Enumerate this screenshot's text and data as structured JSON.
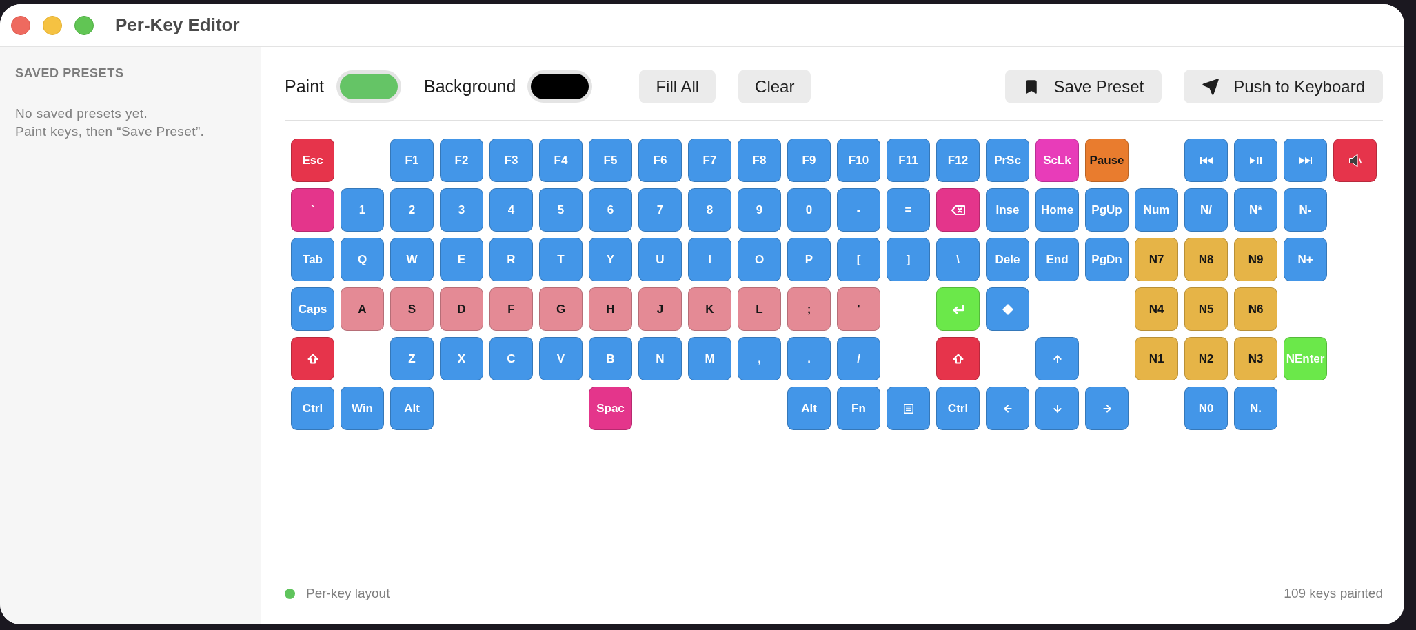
{
  "window": {
    "title": "Per-Key Editor"
  },
  "sidebar": {
    "heading": "SAVED PRESETS",
    "empty_message": [
      "No saved presets yet.",
      "Paint keys, then “Save Preset”."
    ]
  },
  "toolbar": {
    "paint": {
      "label": "Paint",
      "color": "#65c466"
    },
    "background": {
      "label": "Background",
      "color": "#000000"
    },
    "edit_buttons": [
      "Fill All",
      "Clear"
    ],
    "action_buttons": [
      {
        "kind": "bookmark",
        "label": "Save Preset"
      },
      {
        "kind": "send",
        "label": "Push to Keyboard"
      }
    ]
  },
  "keyboard": {
    "rows": [
      {
        "keys": [
          {
            "kind": "text",
            "label": "Esc",
            "color": "#e6344b",
            "dark_label": false
          },
          {
            "kind": "text",
            "label": "F1",
            "color": "#4396e8",
            "dark_label": false
          },
          {
            "kind": "text",
            "label": "F2",
            "color": "#4396e8",
            "dark_label": false
          },
          {
            "kind": "text",
            "label": "F3",
            "color": "#4396e8",
            "dark_label": false
          },
          {
            "kind": "text",
            "label": "F4",
            "color": "#4396e8",
            "dark_label": false
          },
          {
            "kind": "text",
            "label": "F5",
            "color": "#4396e8",
            "dark_label": false
          },
          {
            "kind": "text",
            "label": "F6",
            "color": "#4396e8",
            "dark_label": false
          },
          {
            "kind": "text",
            "label": "F7",
            "color": "#4396e8",
            "dark_label": false
          },
          {
            "kind": "text",
            "label": "F8",
            "color": "#4396e8",
            "dark_label": false
          },
          {
            "kind": "text",
            "label": "F9",
            "color": "#4396e8",
            "dark_label": false
          },
          {
            "kind": "text",
            "label": "F10",
            "color": "#4396e8",
            "dark_label": false
          },
          {
            "kind": "text",
            "label": "F11",
            "color": "#4396e8",
            "dark_label": false
          },
          {
            "kind": "text",
            "label": "F12",
            "color": "#4396e8",
            "dark_label": false
          },
          {
            "kind": "text",
            "label": "PrSc",
            "color": "#4396e8",
            "dark_label": false
          },
          {
            "kind": "text",
            "label": "ScLk",
            "color": "#e83cb9",
            "dark_label": false
          },
          {
            "kind": "text",
            "label": "Pause",
            "color": "#e97c2e",
            "dark_label": true
          },
          {
            "kind": "previous",
            "color": "#4396e8",
            "dark_label": false
          },
          {
            "kind": "playpause",
            "color": "#4396e8",
            "dark_label": false
          },
          {
            "kind": "next",
            "color": "#4396e8",
            "dark_label": false
          },
          {
            "kind": "mute",
            "color": "#e6344b",
            "dark_label": false
          }
        ]
      },
      {
        "keys": [
          {
            "kind": "text",
            "label": "`",
            "color": "#e4358b",
            "dark_label": false
          },
          {
            "kind": "text",
            "label": "1",
            "color": "#4396e8",
            "dark_label": false
          },
          {
            "kind": "text",
            "label": "2",
            "color": "#4396e8",
            "dark_label": false
          },
          {
            "kind": "text",
            "label": "3",
            "color": "#4396e8",
            "dark_label": false
          },
          {
            "kind": "text",
            "label": "4",
            "color": "#4396e8",
            "dark_label": false
          },
          {
            "kind": "text",
            "label": "5",
            "color": "#4396e8",
            "dark_label": false
          },
          {
            "kind": "text",
            "label": "6",
            "color": "#4396e8",
            "dark_label": false
          },
          {
            "kind": "text",
            "label": "7",
            "color": "#4396e8",
            "dark_label": false
          },
          {
            "kind": "text",
            "label": "8",
            "color": "#4396e8",
            "dark_label": false
          },
          {
            "kind": "text",
            "label": "9",
            "color": "#4396e8",
            "dark_label": false
          },
          {
            "kind": "text",
            "label": "0",
            "color": "#4396e8",
            "dark_label": false
          },
          {
            "kind": "text",
            "label": "-",
            "color": "#4396e8",
            "dark_label": false
          },
          {
            "kind": "text",
            "label": "=",
            "color": "#4396e8",
            "dark_label": false
          },
          {
            "kind": "backspace",
            "color": "#e4358b",
            "dark_label": false
          },
          {
            "kind": "text",
            "label": "Inse",
            "color": "#4396e8",
            "dark_label": false
          },
          {
            "kind": "text",
            "label": "Home",
            "color": "#4396e8",
            "dark_label": false
          },
          {
            "kind": "text",
            "label": "PgUp",
            "color": "#4396e8",
            "dark_label": false
          },
          {
            "kind": "text",
            "label": "Num",
            "color": "#4396e8",
            "dark_label": false
          },
          {
            "kind": "text",
            "label": "N/",
            "color": "#4396e8",
            "dark_label": false
          },
          {
            "kind": "text",
            "label": "N*",
            "color": "#4396e8",
            "dark_label": false
          },
          {
            "kind": "text",
            "label": "N-",
            "color": "#4396e8",
            "dark_label": false
          }
        ]
      },
      {
        "keys": [
          {
            "kind": "text",
            "label": "Tab",
            "color": "#4396e8",
            "dark_label": false
          },
          {
            "kind": "text",
            "label": "Q",
            "color": "#4396e8",
            "dark_label": false
          },
          {
            "kind": "text",
            "label": "W",
            "color": "#4396e8",
            "dark_label": false
          },
          {
            "kind": "text",
            "label": "E",
            "color": "#4396e8",
            "dark_label": false
          },
          {
            "kind": "text",
            "label": "R",
            "color": "#4396e8",
            "dark_label": false
          },
          {
            "kind": "text",
            "label": "T",
            "color": "#4396e8",
            "dark_label": false
          },
          {
            "kind": "text",
            "label": "Y",
            "color": "#4396e8",
            "dark_label": false
          },
          {
            "kind": "text",
            "label": "U",
            "color": "#4396e8",
            "dark_label": false
          },
          {
            "kind": "text",
            "label": "I",
            "color": "#4396e8",
            "dark_label": false
          },
          {
            "kind": "text",
            "label": "O",
            "color": "#4396e8",
            "dark_label": false
          },
          {
            "kind": "text",
            "label": "P",
            "color": "#4396e8",
            "dark_label": false
          },
          {
            "kind": "text",
            "label": "[",
            "color": "#4396e8",
            "dark_label": false
          },
          {
            "kind": "text",
            "label": "]",
            "color": "#4396e8",
            "dark_label": false
          },
          {
            "kind": "text",
            "label": "\\",
            "color": "#4396e8",
            "dark_label": false
          },
          {
            "kind": "text",
            "label": "Dele",
            "color": "#4396e8",
            "dark_label": false
          },
          {
            "kind": "text",
            "label": "End",
            "color": "#4396e8",
            "dark_label": false
          },
          {
            "kind": "text",
            "label": "PgDn",
            "color": "#4396e8",
            "dark_label": false
          },
          {
            "kind": "text",
            "label": "N7",
            "color": "#e6b447",
            "dark_label": true
          },
          {
            "kind": "text",
            "label": "N8",
            "color": "#e6b447",
            "dark_label": true
          },
          {
            "kind": "text",
            "label": "N9",
            "color": "#e6b447",
            "dark_label": true
          },
          {
            "kind": "text",
            "label": "N+",
            "color": "#4396e8",
            "dark_label": false
          }
        ]
      },
      {
        "keys": [
          {
            "kind": "text",
            "label": "Caps",
            "color": "#4396e8",
            "dark_label": false
          },
          {
            "kind": "text",
            "label": "A",
            "color": "#e48a95",
            "dark_label": true
          },
          {
            "kind": "text",
            "label": "S",
            "color": "#e48a95",
            "dark_label": true
          },
          {
            "kind": "text",
            "label": "D",
            "color": "#e48a95",
            "dark_label": true
          },
          {
            "kind": "text",
            "label": "F",
            "color": "#e48a95",
            "dark_label": true
          },
          {
            "kind": "text",
            "label": "G",
            "color": "#e48a95",
            "dark_label": true
          },
          {
            "kind": "text",
            "label": "H",
            "color": "#e48a95",
            "dark_label": true
          },
          {
            "kind": "text",
            "label": "J",
            "color": "#e48a95",
            "dark_label": true
          },
          {
            "kind": "text",
            "label": "K",
            "color": "#e48a95",
            "dark_label": true
          },
          {
            "kind": "text",
            "label": "L",
            "color": "#e48a95",
            "dark_label": true
          },
          {
            "kind": "text",
            "label": ";",
            "color": "#e48a95",
            "dark_label": true
          },
          {
            "kind": "text",
            "label": "'",
            "color": "#e48a95",
            "dark_label": true
          },
          {
            "kind": "enter",
            "color": "#6be84a",
            "dark_label": false
          },
          {
            "kind": "diamond",
            "color": "#4396e8",
            "dark_label": false
          },
          {
            "kind": "text",
            "label": "N4",
            "color": "#e6b447",
            "dark_label": true
          },
          {
            "kind": "text",
            "label": "N5",
            "color": "#e6b447",
            "dark_label": true
          },
          {
            "kind": "text",
            "label": "N6",
            "color": "#e6b447",
            "dark_label": true
          }
        ]
      },
      {
        "keys": [
          {
            "kind": "shift",
            "color": "#e6344b",
            "dark_label": false
          },
          {
            "kind": "text",
            "label": "Z",
            "color": "#4396e8",
            "dark_label": false
          },
          {
            "kind": "text",
            "label": "X",
            "color": "#4396e8",
            "dark_label": false
          },
          {
            "kind": "text",
            "label": "C",
            "color": "#4396e8",
            "dark_label": false
          },
          {
            "kind": "text",
            "label": "V",
            "color": "#4396e8",
            "dark_label": false
          },
          {
            "kind": "text",
            "label": "B",
            "color": "#4396e8",
            "dark_label": false
          },
          {
            "kind": "text",
            "label": "N",
            "color": "#4396e8",
            "dark_label": false
          },
          {
            "kind": "text",
            "label": "M",
            "color": "#4396e8",
            "dark_label": false
          },
          {
            "kind": "text",
            "label": ",",
            "color": "#4396e8",
            "dark_label": false
          },
          {
            "kind": "text",
            "label": ".",
            "color": "#4396e8",
            "dark_label": false
          },
          {
            "kind": "text",
            "label": "/",
            "color": "#4396e8",
            "dark_label": false
          },
          {
            "kind": "shift",
            "color": "#e6344b",
            "dark_label": false
          },
          {
            "kind": "up",
            "color": "#4396e8",
            "dark_label": false
          },
          {
            "kind": "text",
            "label": "N1",
            "color": "#e6b447",
            "dark_label": true
          },
          {
            "kind": "text",
            "label": "N2",
            "color": "#e6b447",
            "dark_label": true
          },
          {
            "kind": "text",
            "label": "N3",
            "color": "#e6b447",
            "dark_label": true
          },
          {
            "kind": "text",
            "label": "NEnter",
            "color": "#6be84a",
            "dark_label": false
          }
        ]
      },
      {
        "keys": [
          {
            "kind": "text",
            "label": "Ctrl",
            "color": "#4396e8",
            "dark_label": false
          },
          {
            "kind": "text",
            "label": "Win",
            "color": "#4396e8",
            "dark_label": false
          },
          {
            "kind": "text",
            "label": "Alt",
            "color": "#4396e8",
            "dark_label": false
          },
          {
            "kind": "text",
            "label": "Spac",
            "color": "#e4358b",
            "dark_label": false
          },
          {
            "kind": "text",
            "label": "Alt",
            "color": "#4396e8",
            "dark_label": false
          },
          {
            "kind": "text",
            "label": "Fn",
            "color": "#4396e8",
            "dark_label": false
          },
          {
            "kind": "menu",
            "color": "#4396e8",
            "dark_label": false
          },
          {
            "kind": "text",
            "label": "Ctrl",
            "color": "#4396e8",
            "dark_label": false
          },
          {
            "kind": "left",
            "color": "#4396e8",
            "dark_label": false
          },
          {
            "kind": "down",
            "color": "#4396e8",
            "dark_label": false
          },
          {
            "kind": "right",
            "color": "#4396e8",
            "dark_label": false
          },
          {
            "kind": "text",
            "label": "N0",
            "color": "#4396e8",
            "dark_label": false
          },
          {
            "kind": "text",
            "label": "N.",
            "color": "#4396e8",
            "dark_label": false
          }
        ]
      }
    ]
  },
  "status_bar": {
    "indicator": {
      "label": "Per-key layout",
      "color": "#5fc45c"
    },
    "count": "109 keys painted"
  }
}
